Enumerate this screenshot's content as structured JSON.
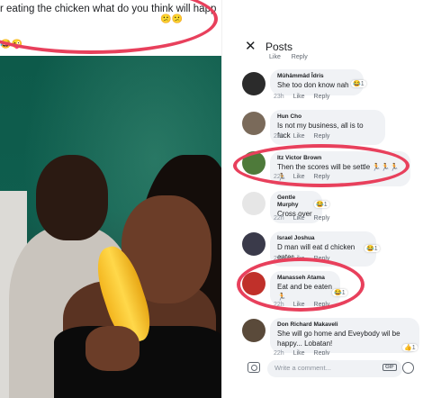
{
  "left": {
    "caption": "r eating the chicken what do you think will happ",
    "caption_emoji_line1": "😕😕",
    "caption_emoji_line2": "😂😜"
  },
  "header": {
    "title": "Posts",
    "close": "✕"
  },
  "prev_actions": {
    "time": "",
    "like": "Like",
    "reply": "Reply"
  },
  "comments": [
    {
      "name": "Mûhâmmâd Îdris",
      "text": "She too don know nah",
      "time": "23h",
      "like": "Like",
      "reply": "Reply",
      "react": "😂1"
    },
    {
      "name": "Hun Cho",
      "text": "Is not my business, all is to fuck",
      "time": "22h",
      "like": "Like",
      "reply": "Reply",
      "react": ""
    },
    {
      "name": "Itz Victor Brown",
      "text": "Then the scores will be settle 🏃🏃🏃🏃",
      "time": "22h",
      "like": "Like",
      "reply": "Reply",
      "react": ""
    },
    {
      "name": "Gentle Murphy",
      "text": "Cross over",
      "time": "22h",
      "like": "Like",
      "reply": "Reply",
      "react": "😂1"
    },
    {
      "name": "Israel Joshua",
      "text": "D man will eat d chicken eater",
      "time": "22h",
      "like": "Like",
      "reply": "Reply",
      "react": "😂1"
    },
    {
      "name": "Manasseh Atama",
      "text": "Eat and be eaten 🏃",
      "time": "22h",
      "like": "Like",
      "reply": "Reply",
      "react": "😂1"
    },
    {
      "name": "Don Richard Makaveli",
      "text": "She will go home and Eveybody wil be happy... Lobatan!",
      "time": "22h",
      "like": "Like",
      "reply": "Reply",
      "react": "👍1"
    }
  ],
  "composer": {
    "placeholder": "Write a comment...",
    "gif": "GIF"
  }
}
